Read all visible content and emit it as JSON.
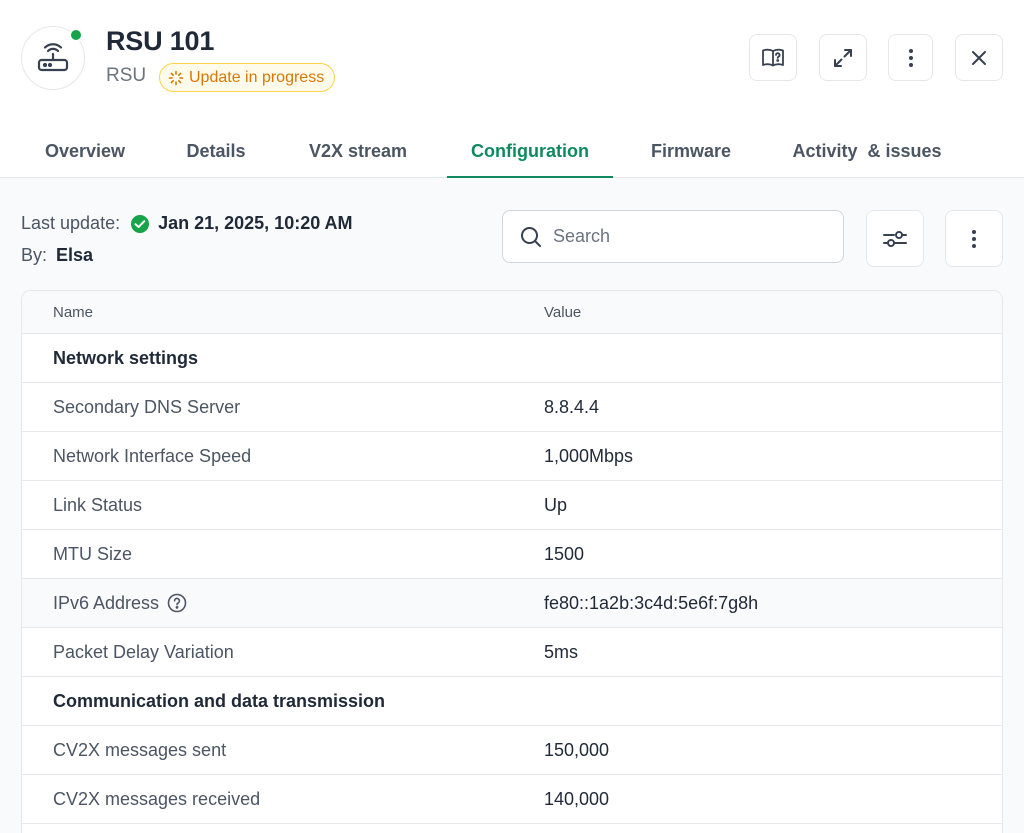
{
  "device": {
    "title": "RSU 101",
    "type": "RSU",
    "status_badge": "Update in progress",
    "status_color": "#16a34a",
    "icon": "router-icon"
  },
  "header_actions": [
    {
      "name": "manual-button",
      "icon": "book-question-icon"
    },
    {
      "name": "expand-button",
      "icon": "expand-icon"
    },
    {
      "name": "more-options-button",
      "icon": "vertical-dots-icon"
    },
    {
      "name": "close-button",
      "icon": "close-icon"
    }
  ],
  "tabs": [
    {
      "label": "Overview",
      "active": false
    },
    {
      "label": "Details",
      "active": false
    },
    {
      "label": "V2X stream",
      "active": false
    },
    {
      "label": "Configuration",
      "active": true
    },
    {
      "label": "Firmware",
      "active": false
    },
    {
      "label": "Activity  & issues",
      "active": false
    }
  ],
  "meta": {
    "last_update_label": "Last update:",
    "last_update_value": "Jan 21, 2025, 10:20 AM",
    "by_label": "By:",
    "by_value": "Elsa"
  },
  "search": {
    "placeholder": "Search"
  },
  "table": {
    "headers": {
      "name": "Name",
      "value": "Value"
    },
    "rows": [
      {
        "kind": "group",
        "name": "Network settings",
        "value": ""
      },
      {
        "kind": "item",
        "name": "Secondary DNS Server",
        "value": "8.8.4.4"
      },
      {
        "kind": "item",
        "name": "Network Interface Speed",
        "value": "1,000Mbps"
      },
      {
        "kind": "item",
        "name": "Link Status",
        "value": "Up"
      },
      {
        "kind": "item",
        "name": "MTU Size",
        "value": "1500"
      },
      {
        "kind": "item",
        "name": "IPv6 Address",
        "value": "fe80::1a2b:3c4d:5e6f:7g8h",
        "help_icon": true
      },
      {
        "kind": "item",
        "name": "Packet Delay Variation",
        "value": "5ms"
      },
      {
        "kind": "group",
        "name": "Communication and data transmission",
        "value": ""
      },
      {
        "kind": "item",
        "name": "CV2X messages sent",
        "value": "150,000"
      },
      {
        "kind": "item",
        "name": "CV2X messages received",
        "value": "140,000"
      },
      {
        "kind": "item",
        "name": "",
        "value": ""
      }
    ]
  },
  "colors": {
    "accent": "#0f8a5f",
    "badge_text": "#d97706",
    "badge_border": "#fcd34d",
    "badge_bg": "#fffbeb"
  }
}
